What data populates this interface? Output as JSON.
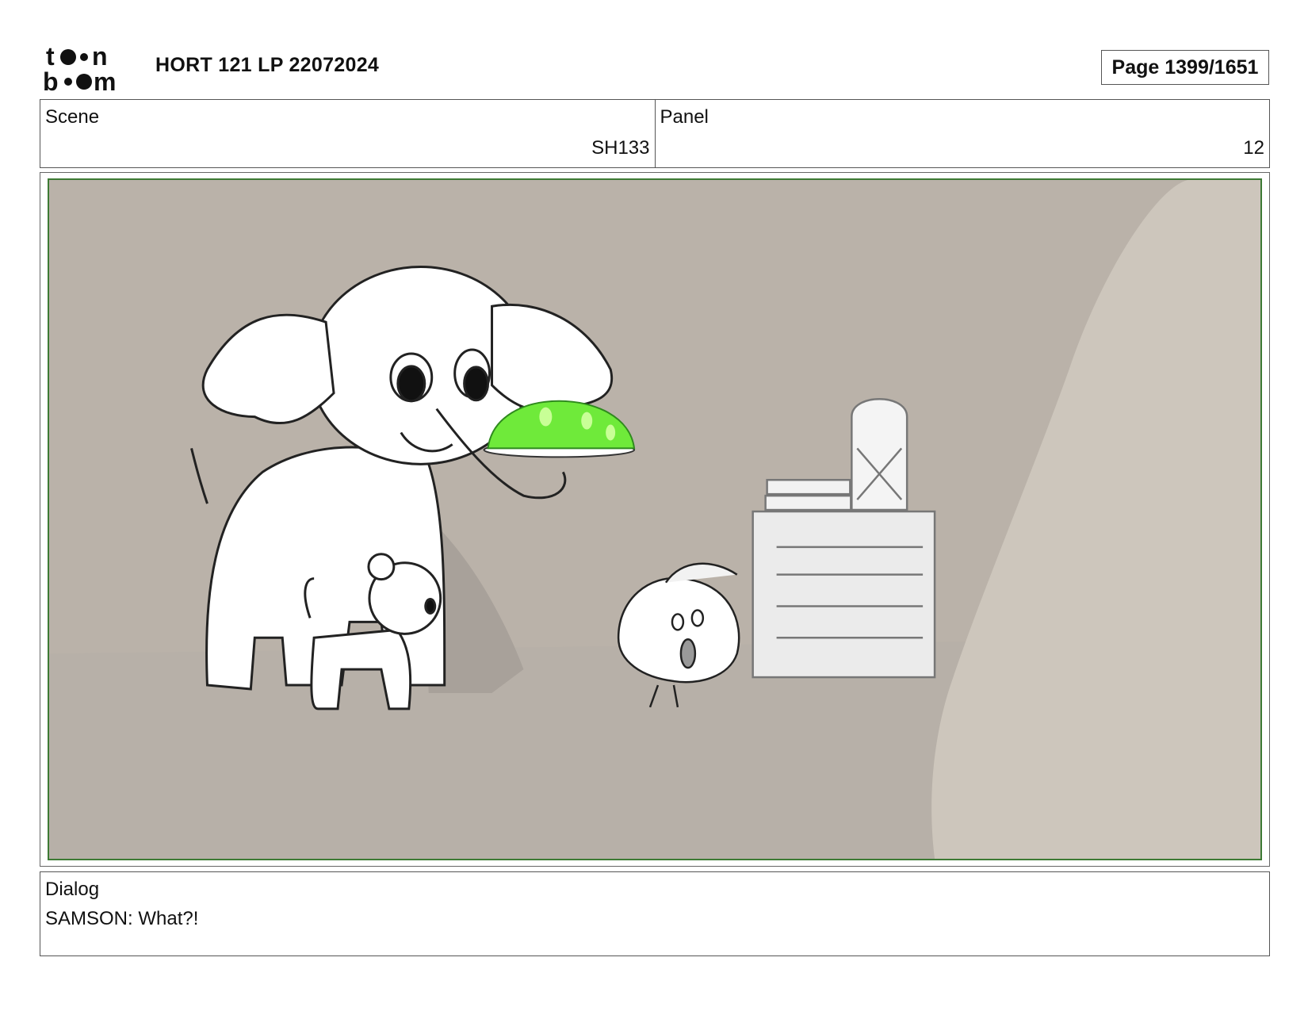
{
  "header": {
    "brand": "toon boom",
    "document_title": "HORT 121 LP 22072024",
    "page_label": "Page 1399/1651"
  },
  "meta": {
    "scene_label": "Scene",
    "scene_value": "SH133",
    "panel_label": "Panel",
    "panel_value": "12"
  },
  "panel": {
    "frame_color": "#3d7a34",
    "background_color": "#b9b2aa",
    "accent_color": "#6fea3a"
  },
  "dialog": {
    "label": "Dialog",
    "text": "SAMSON: What?!"
  }
}
